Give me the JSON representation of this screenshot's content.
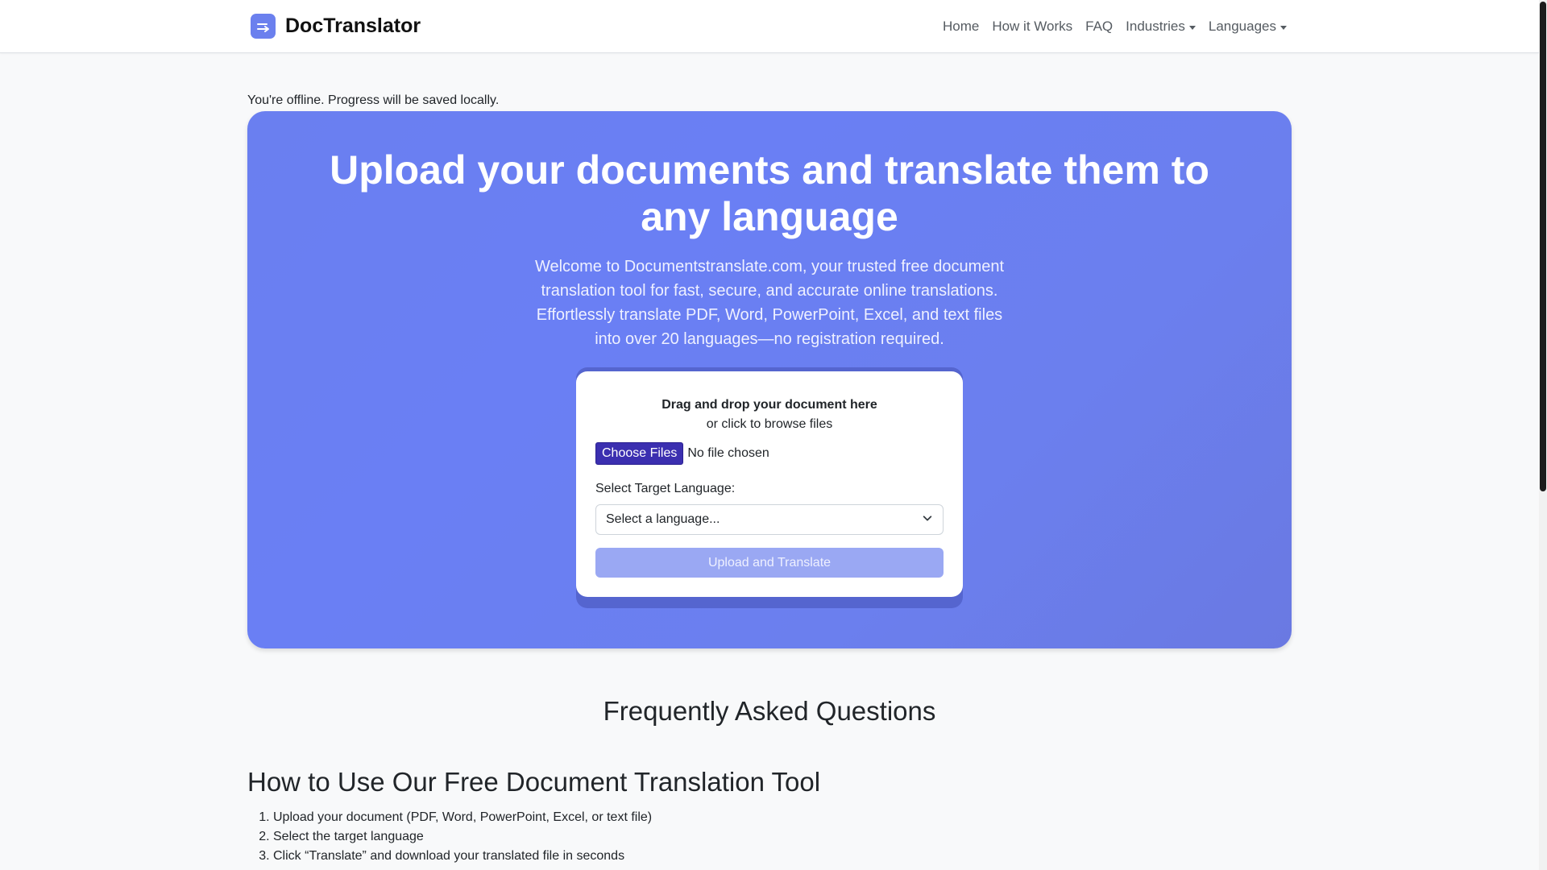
{
  "navbar": {
    "brand": "DocTranslator",
    "links": [
      {
        "label": "Home"
      },
      {
        "label": "How it Works"
      },
      {
        "label": "FAQ"
      },
      {
        "label": "Industries"
      },
      {
        "label": "Languages"
      }
    ]
  },
  "status": {
    "offline_message": "You're offline. Progress will be saved locally."
  },
  "hero": {
    "title": "Upload your documents and translate them to any language",
    "description": "Welcome to Documentstranslate.com, your trusted free document translation tool for fast, secure, and accurate online translations. Effortlessly translate PDF, Word, PowerPoint, Excel, and text files into over 20 languages—no registration required."
  },
  "upload_card": {
    "drop_title": "Drag and drop your document here",
    "drop_subtitle": "or click to browse files",
    "choose_files_label": "Choose Files",
    "file_status": "No file chosen",
    "language_label": "Select Target Language:",
    "language_select_value": "Select a language...",
    "submit_label": "Upload and Translate"
  },
  "faq": {
    "title": "Frequently Asked Questions",
    "howto_title": "How to Use Our Free Document Translation Tool",
    "steps": [
      "Upload your document (PDF, Word, PowerPoint, Excel, or text file)",
      "Select the target language",
      "Click “Translate” and download your translated file in seconds"
    ]
  },
  "colors": {
    "accent": "#6b80ee",
    "choose_button": "#3b2fb0",
    "disabled_button": "#9aa8f3"
  },
  "icons": {
    "brand": "translate-arrow-icon",
    "select": "chevron-down-icon",
    "dropdown": "caret-down-icon"
  }
}
